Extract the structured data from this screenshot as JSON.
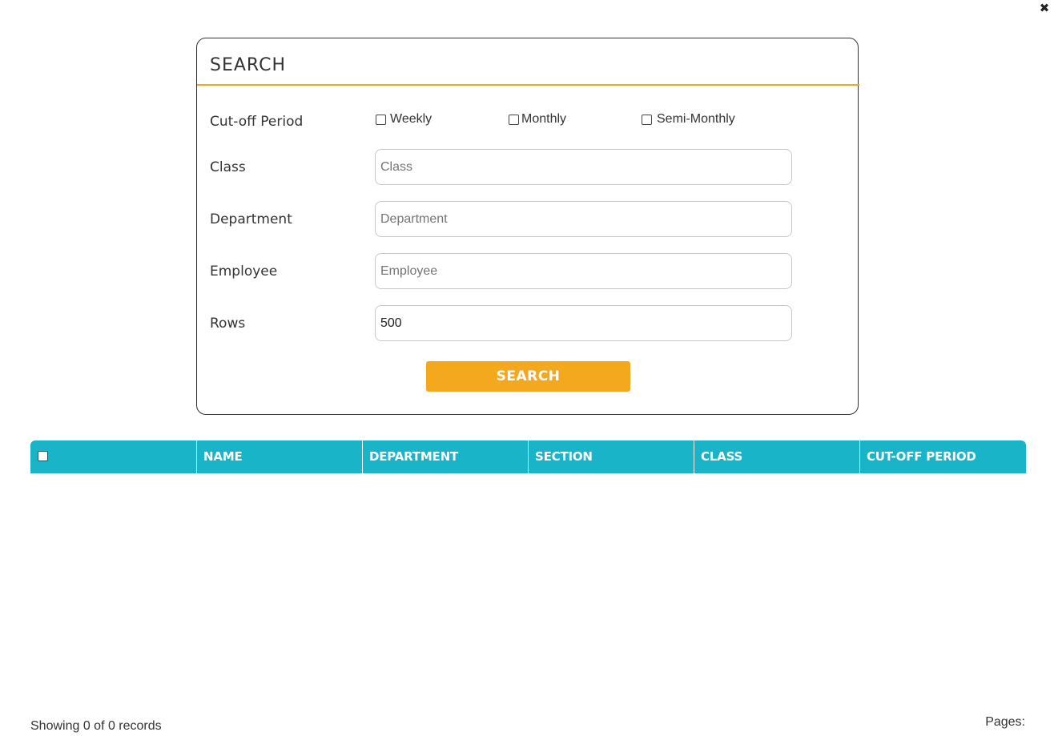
{
  "close_icon": "close-icon",
  "search_panel": {
    "title": "SEARCH",
    "cutoff_label": "Cut-off Period",
    "cutoff_options": [
      "Weekly",
      "Monthly",
      "Semi-Monthly"
    ],
    "class_label": "Class",
    "class_placeholder": "Class",
    "department_label": "Department",
    "department_placeholder": "Department",
    "employee_label": "Employee",
    "employee_placeholder": "Employee",
    "rows_label": "Rows",
    "rows_value": "500",
    "search_button": "SEARCH",
    "accent_color": "#f4a81e"
  },
  "table": {
    "header_color": "#1ab4c9",
    "columns": [
      "NAME",
      "DEPARTMENT",
      "SECTION",
      "CLASS",
      "CUT-OFF PERIOD"
    ]
  },
  "footer": {
    "records_text": "Showing 0 of 0 records",
    "pages_label": "Pages:"
  }
}
